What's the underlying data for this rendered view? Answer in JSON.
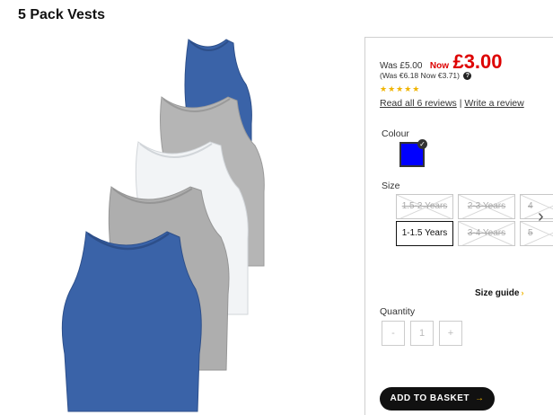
{
  "product": {
    "title": "5 Pack Vests"
  },
  "price": {
    "was": "Was £5.00",
    "now_label": "Now",
    "now_price": "£3.00",
    "euro": "(Was €6.18 Now €3.71)",
    "help_icon": "?",
    "stars": "★★★★★",
    "rating": 5
  },
  "reviews": {
    "read_all": "Read all 6 reviews",
    "separator": "|",
    "write": "Write a review"
  },
  "colour": {
    "label": "Colour",
    "swatch_color": "#0000ff",
    "check": "✓"
  },
  "size": {
    "label": "Size",
    "options": [
      {
        "label": "1.5-2 Years",
        "available": false,
        "selected": false
      },
      {
        "label": "2-3 Years",
        "available": false,
        "selected": false
      },
      {
        "label": "4",
        "available": false,
        "selected": false
      },
      {
        "label": "1-1.5 Years",
        "available": true,
        "selected": true
      },
      {
        "label": "3-4 Years",
        "available": false,
        "selected": false
      },
      {
        "label": "5",
        "available": false,
        "selected": false
      }
    ],
    "next_icon": "›",
    "guide": "Size guide",
    "guide_arrow": "›"
  },
  "quantity": {
    "label": "Quantity",
    "minus": "-",
    "value": "1",
    "plus": "+"
  },
  "basket": {
    "label": "ADD TO BASKET",
    "arrow": "→"
  },
  "colors": {
    "price_red": "#dd0000",
    "accent_yellow": "#f0b400",
    "vest_blue": "#3a63a8",
    "vest_grey": "#b0b0b0",
    "vest_white": "#f2f4f6"
  }
}
